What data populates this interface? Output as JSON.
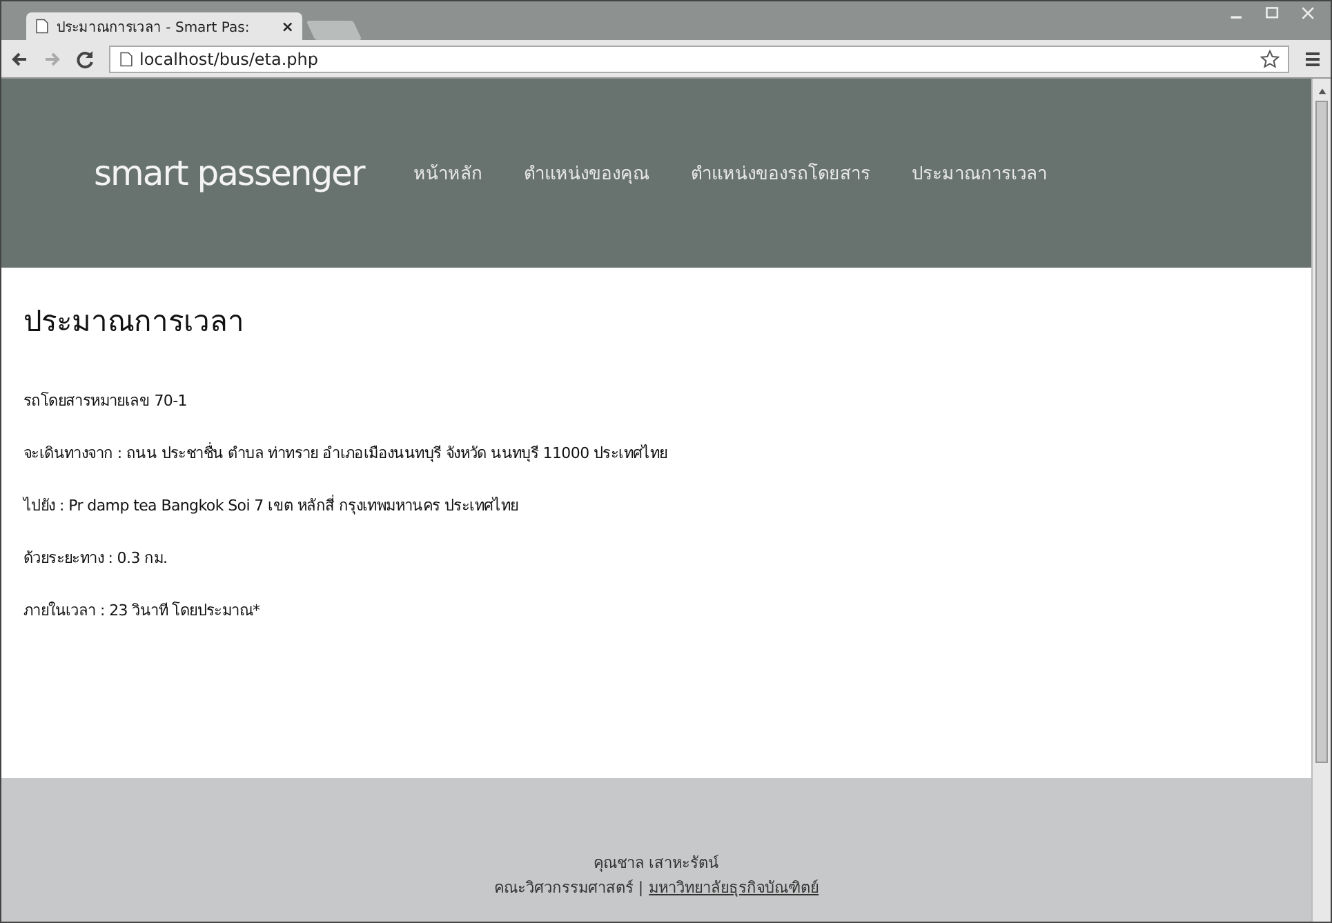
{
  "browser": {
    "tab_title": "ประมาณการเวลา - Smart Pas:",
    "tab_close": "×",
    "url": "localhost/bus/eta.php"
  },
  "navbar": {
    "brand": "smart passenger",
    "links": [
      "หน้าหลัก",
      "ตำแหน่งของคุณ",
      "ตำแหน่งของรถโดยสาร",
      "ประมาณการเวลา"
    ]
  },
  "content": {
    "heading": "ประมาณการเวลา",
    "lines": [
      "รถโดยสารหมายเลข 70-1",
      "จะเดินทางจาก : ถนน ประชาชื่น ตำบล ท่าทราย อำเภอเมืองนนทบุรี จังหวัด นนทบุรี 11000 ประเทศไทย",
      "ไปยัง : Pr damp tea Bangkok Soi 7 เขต หลักสี่ กรุงเทพมหานคร ประเทศไทย",
      "ด้วยระยะทาง : 0.3 กม.",
      "ภายในเวลา : 23 วินาที โดยประมาณ*"
    ]
  },
  "footer": {
    "author": "คุณชาล เสาหะรัตน์",
    "faculty": "คณะวิศวกรรมศาสตร์ |",
    "university": "มหาวิทยาลัยธุรกิจบัณฑิตย์"
  }
}
